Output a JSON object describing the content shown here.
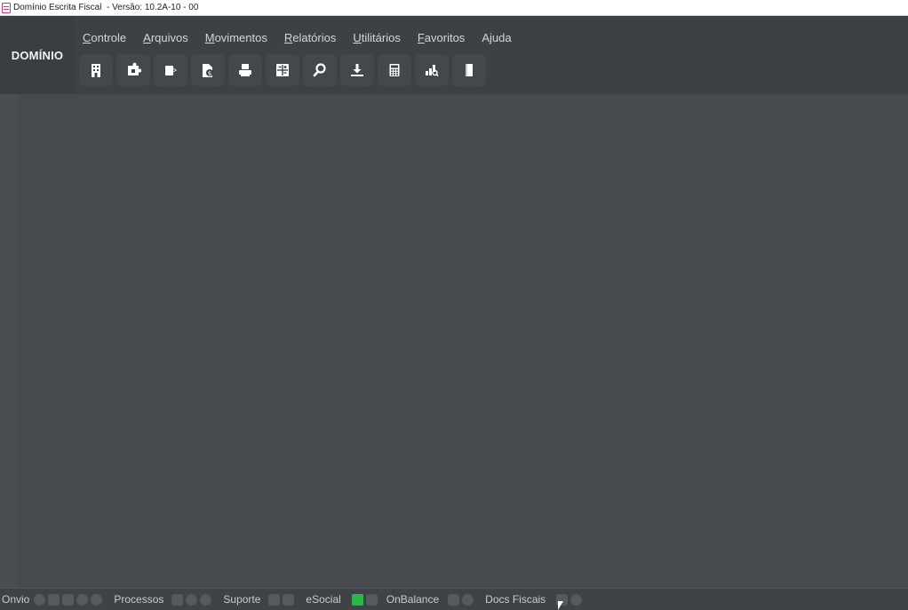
{
  "window": {
    "title": "Domínio Escrita Fiscal  - Versão: 10.2A-10 - 00"
  },
  "brand": {
    "label": "DOMÍNIO"
  },
  "menu": [
    {
      "label": "Controle"
    },
    {
      "label": "Arquivos"
    },
    {
      "label": "Movimentos"
    },
    {
      "label": "Relatórios"
    },
    {
      "label": "Utilitários"
    },
    {
      "label": "Favoritos"
    },
    {
      "label": "Ajuda"
    }
  ],
  "toolbar": {
    "icons": [
      "building-icon",
      "puzzle-icon",
      "export-icon",
      "document-dollar-icon",
      "printer-icon",
      "spreadsheet-icon",
      "search-icon",
      "download-icon",
      "calculator-icon",
      "chart-search-icon",
      "book-icon"
    ]
  },
  "statusbar": {
    "onvio": "Onvio",
    "processos": "Processos",
    "suporte": "Suporte",
    "esocial": "eSocial",
    "onbalance": "OnBalance",
    "docs_fiscais": "Docs Fiscais"
  },
  "colors": {
    "background": "#464a4f",
    "header": "#3d4044",
    "statusbar": "#3f4246",
    "esocial_status": "#2bb84a"
  }
}
